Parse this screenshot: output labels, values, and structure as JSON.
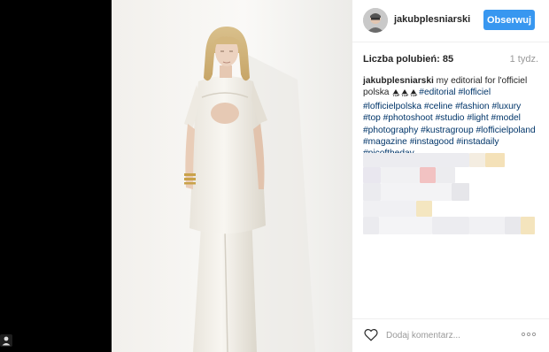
{
  "post": {
    "username": "jakubplesniarski",
    "follow_label": "Obserwuj",
    "likes_label": "Liczba polubień:",
    "likes_count": "85",
    "time_ago": "1 tydz.",
    "caption": {
      "username": "jakubplesniarski",
      "text": " my editorial for l'officiel polska ",
      "emoji_tops": [
        "TOP",
        "TOP",
        "TOP"
      ],
      "hashtags": [
        "#editorial",
        "#lofficiel",
        "#lofficielpolska",
        "#celine",
        "#fashion",
        "#luxury",
        "#top",
        "#photoshoot",
        "#studio",
        "#light",
        "#model",
        "#photography",
        "#kustragroup",
        "#lofficielpoland",
        "#magazine",
        "#instagood",
        "#instadaily",
        "#picoftheday"
      ]
    },
    "comment_placeholder": "Dodaj komentarz...",
    "icons": {
      "like": "heart-icon",
      "options": "more-options-icon",
      "user": "user-icon"
    },
    "colors": {
      "follow_button": "#3897f0",
      "hashtag": "#003569",
      "backdrop": "#000000"
    }
  }
}
